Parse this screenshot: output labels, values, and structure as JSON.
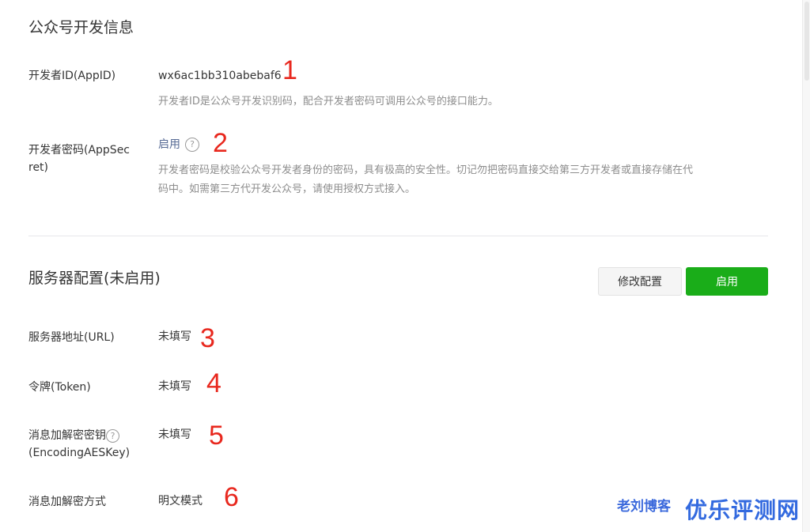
{
  "wechat_info": {
    "title": "公众号开发信息",
    "appid": {
      "label": "开发者ID(AppID)",
      "value": "wx6ac1bb310abebaf6",
      "desc": "开发者ID是公众号开发识别码，配合开发者密码可调用公众号的接口能力。"
    },
    "appsecret": {
      "label_line1": "开发者密码(AppSec",
      "label_line2": "ret)",
      "action": "启用",
      "help_icon": "?",
      "desc_line1": "开发者密码是校验公众号开发者身份的密码，具有极高的安全性。切记勿把密码直接交给第三方开发者或直接存储在代",
      "desc_line2": "码中。如需第三方代开发公众号，请使用授权方式接入。"
    }
  },
  "server_config": {
    "title": "服务器配置(未启用)",
    "modify_button": "修改配置",
    "enable_button": "启用",
    "url": {
      "label": "服务器地址(URL)",
      "value": "未填写"
    },
    "token": {
      "label": "令牌(Token)",
      "value": "未填写"
    },
    "aes_key": {
      "label_line1": "消息加解密密钥",
      "label_line2": "(EncodingAESKey)",
      "help_icon": "?",
      "value": "未填写"
    },
    "encrypt_mode": {
      "label": "消息加解密方式",
      "value": "明文模式"
    }
  },
  "markers": [
    "1",
    "2",
    "3",
    "4",
    "5",
    "6"
  ],
  "watermark": {
    "blog": "老刘博客",
    "site": "优乐评测网"
  },
  "colors": {
    "primary_green": "#1aad19",
    "link_blue": "#576b95",
    "marker_red": "#e8281e"
  }
}
